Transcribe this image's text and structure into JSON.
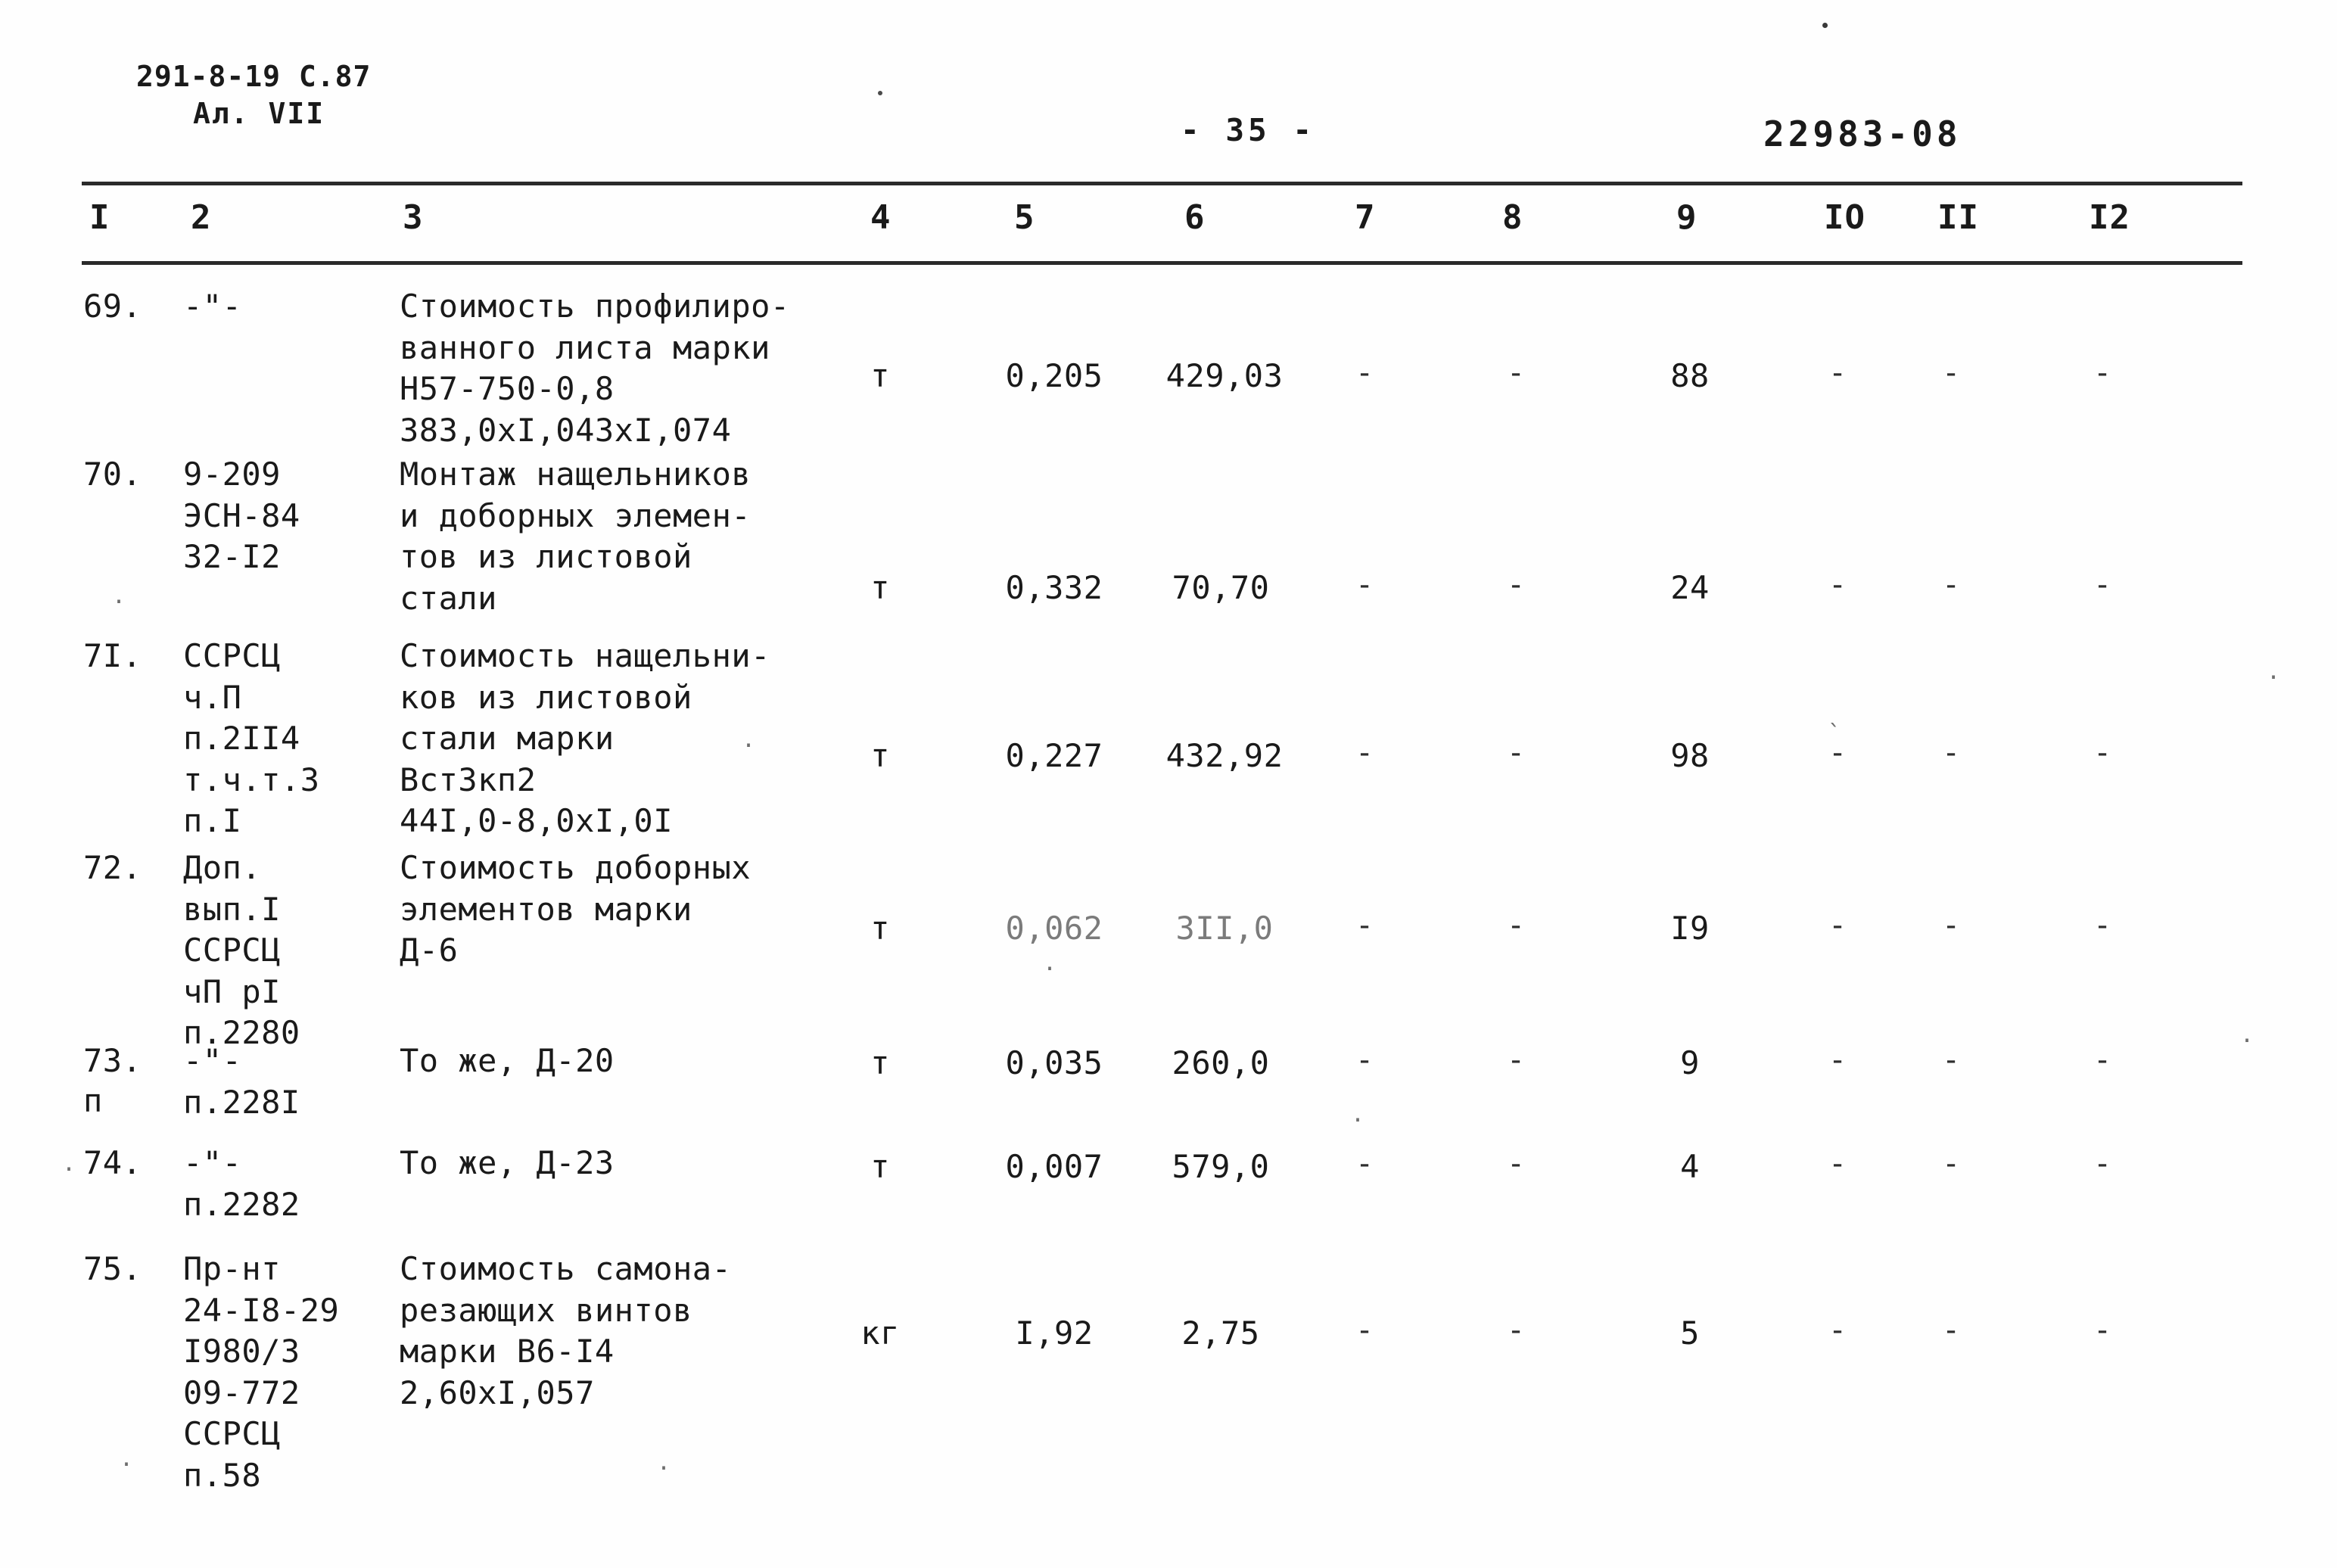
{
  "header": {
    "doc_ref_line1": "291-8-19 С.87",
    "doc_ref_line2": "Ал. VII",
    "page_number": "- 35 -",
    "doc_number": "22983-08"
  },
  "table": {
    "column_headers": [
      "I",
      "2",
      "3",
      "4",
      "5",
      "6",
      "7",
      "8",
      "9",
      "IO",
      "II",
      "I2"
    ],
    "rows": [
      {
        "no": "69.",
        "code": "-\"-",
        "description": "Стоимость профилиро-\nванного листа марки\nН57-750-0,8\n383,0xI,043xI,074",
        "unit": "т",
        "c5": "0,205",
        "c6": "429,03",
        "c7": "-",
        "c8": "-",
        "c9": "88",
        "c10": "-",
        "c11": "-",
        "c12": "-"
      },
      {
        "no": "70.",
        "code": "9-209\nЭСН-84\n32-I2",
        "description": "Монтаж нащельников\nи доборных элемен-\nтов из листовой\nстали",
        "unit": "т",
        "c5": "0,332",
        "c6": "70,70",
        "c7": "-",
        "c8": "-",
        "c9": "24",
        "c10": "-",
        "c11": "-",
        "c12": "-"
      },
      {
        "no": "7I.",
        "code": "ССРСЦ\nч.П\nп.2II4\nт.ч.т.3\nп.I",
        "description": "Стоимость нащельни-\nков из листовой\nстали марки\nВст3кп2\n44I,0-8,0xI,0I",
        "unit": "т",
        "c5": "0,227",
        "c6": "432,92",
        "c7": "-",
        "c8": "-",
        "c9": "98",
        "c10": "-",
        "c11": "-",
        "c12": "-"
      },
      {
        "no": "72.",
        "code": "Доп.\nвып.I\nССРСЦ\nчП рI\nп.2280",
        "description": "Стоимость доборных\nэлементов марки\nД-6",
        "unit": "т",
        "c5": "0,062",
        "c6": "3II,0",
        "c7": "-",
        "c8": "-",
        "c9": "I9",
        "c10": "-",
        "c11": "-",
        "c12": "-"
      },
      {
        "no": "73.",
        "code": "-\"-\nп.228I",
        "description": "То же, Д-20",
        "unit": "т",
        "c5": "0,035",
        "c6": "260,0",
        "c7": "-",
        "c8": "-",
        "c9": "9",
        "c10": "-",
        "c11": "-",
        "c12": "-"
      },
      {
        "no": "74.",
        "code": "-\"-\nп.2282",
        "description": "То же, Д-23",
        "unit": "т",
        "c5": "0,007",
        "c6": "579,0",
        "c7": "-",
        "c8": "-",
        "c9": "4",
        "c10": "-",
        "c11": "-",
        "c12": "-"
      },
      {
        "no": "75.",
        "code": "Пр-нт\n24-I8-29\nI980/3\n09-772\nССРСЦ\nп.58",
        "description": "Стоимость самона-\nрезающих винтов\nмарки В6-I4\n2,60xI,057",
        "unit": "кг",
        "c5": "I,92",
        "c6": "2,75",
        "c7": "-",
        "c8": "-",
        "c9": "5",
        "c10": "-",
        "c11": "-",
        "c12": "-"
      }
    ],
    "stray_marks": {
      "row73_extra": "п"
    }
  }
}
